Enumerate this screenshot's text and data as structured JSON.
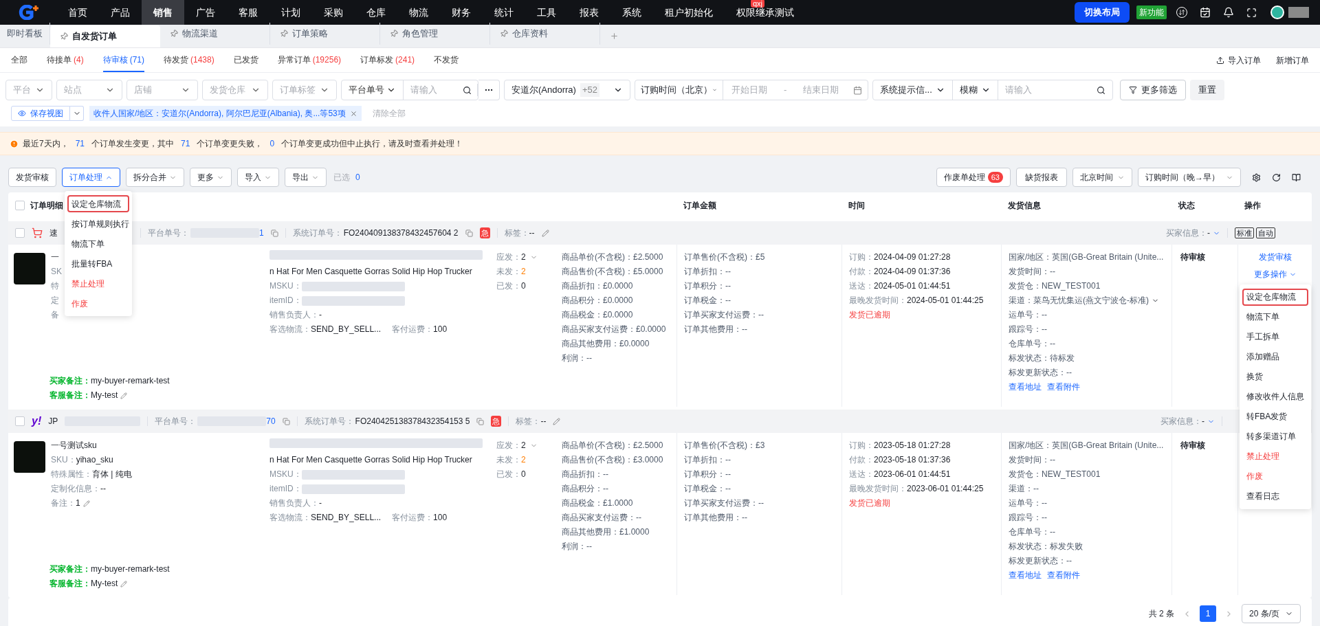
{
  "nav": {
    "items": [
      {
        "label": "首页",
        "selected": false
      },
      {
        "label": "产品",
        "selected": false
      },
      {
        "label": "销售",
        "selected": true
      },
      {
        "label": "广告",
        "selected": false
      },
      {
        "label": "客服",
        "selected": false
      },
      {
        "label": "计划",
        "selected": false
      },
      {
        "label": "采购",
        "selected": false
      },
      {
        "label": "仓库",
        "selected": false
      },
      {
        "label": "物流",
        "selected": false
      },
      {
        "label": "财务",
        "selected": false
      },
      {
        "label": "统计",
        "selected": false
      },
      {
        "label": "工具",
        "selected": false
      },
      {
        "label": "报表",
        "selected": false
      },
      {
        "label": "系统",
        "selected": false
      },
      {
        "label": "租户初始化",
        "selected": false
      },
      {
        "label": "权限继承测试",
        "selected": false,
        "badge": "qxj"
      }
    ],
    "switch_layout": "切换布局",
    "new_feature": "新功能"
  },
  "page_tabs": [
    {
      "label": "即时看板",
      "selected": false,
      "pinned": false
    },
    {
      "label": "自发货订单",
      "selected": true,
      "pinned": true
    },
    {
      "label": "物流渠道",
      "selected": false,
      "pinned": true
    },
    {
      "label": "订单策略",
      "selected": false,
      "pinned": true
    },
    {
      "label": "角色管理",
      "selected": false,
      "pinned": true
    },
    {
      "label": "仓库资料",
      "selected": false,
      "pinned": true
    }
  ],
  "status_tabs": [
    {
      "label": "全部",
      "selected": false
    },
    {
      "label": "待接单",
      "count": "(4)",
      "selected": false
    },
    {
      "label": "待审核",
      "count": "(71)",
      "selected": true
    },
    {
      "label": "待发货",
      "count": "(1438)",
      "selected": false
    },
    {
      "label": "已发货",
      "selected": false
    },
    {
      "label": "异常订单",
      "count": "(19256)",
      "selected": false
    },
    {
      "label": "订单标发",
      "count": "(241)",
      "selected": false
    },
    {
      "label": "不发货",
      "selected": false
    }
  ],
  "header_actions": {
    "import": "导入订单",
    "create": "新增订单"
  },
  "filters": {
    "selects": [
      "平台",
      "站点",
      "店铺",
      "发货仓库",
      "订单标签"
    ],
    "number_search": {
      "type": "平台单号",
      "placeholder": "请输入"
    },
    "country": {
      "value": "安道尔(Andorra)",
      "more": "+52"
    },
    "date": {
      "type": "订购时间（北京）",
      "start": "开始日期",
      "separator": "-",
      "end": "结束日期"
    },
    "text_search": {
      "field": "系统提示信...",
      "mode": "模糊",
      "placeholder": "请输入"
    },
    "more_filters": "更多筛选",
    "reset": "重置"
  },
  "view_bar": {
    "save_view": "保存视图",
    "chip": "收件人国家/地区：安道尔(Andorra), 阿尔巴尼亚(Albania), 奥...等53项",
    "clear_all": "清除全部"
  },
  "alert": [
    {
      "text": "最近7天内，",
      "kind": "plain"
    },
    {
      "text": "71",
      "kind": "number"
    },
    {
      "text": "个订单发生变更，其中",
      "kind": "plain"
    },
    {
      "text": "71",
      "kind": "number"
    },
    {
      "text": "个订单变更失败，",
      "kind": "plain"
    },
    {
      "text": "0",
      "kind": "number"
    },
    {
      "text": "个订单变更成功但中止执行，请及时查看并处理！",
      "kind": "plain"
    }
  ],
  "toolbar": {
    "buttons": [
      {
        "label": "发货审核",
        "kind": "plain",
        "open": false
      },
      {
        "label": "订单处理",
        "kind": "menu",
        "open": true
      },
      {
        "label": "拆分合并",
        "kind": "menu",
        "open": false
      },
      {
        "label": "更多",
        "kind": "menu",
        "open": false
      },
      {
        "label": "导入",
        "kind": "menu",
        "open": false
      },
      {
        "label": "导出",
        "kind": "menu",
        "open": false
      }
    ],
    "selected_label": "已选",
    "selected_count": "0",
    "void_orders": {
      "label": "作废单处理",
      "badge": "63"
    },
    "stockout_report": "缺货报表",
    "timezone": "北京时间",
    "sort": "订购时间（晚→早）"
  },
  "process_menu": [
    {
      "label": "设定仓库物流",
      "kind": "normal",
      "highlighted": true
    },
    {
      "label": "按订单规则执行",
      "kind": "normal",
      "highlighted": false
    },
    {
      "label": "物流下单",
      "kind": "normal",
      "highlighted": false
    },
    {
      "label": "批量转FBA",
      "kind": "normal",
      "highlighted": false
    },
    {
      "label": "禁止处理",
      "kind": "danger",
      "highlighted": false
    },
    {
      "label": "作废",
      "kind": "danger",
      "highlighted": false
    }
  ],
  "table": {
    "select_all": {
      "label": "订单明细",
      "checked": false
    },
    "columns": [
      "订单金额",
      "时间",
      "发货信息",
      "状态",
      "操作"
    ]
  },
  "orders": [
    {
      "checked": false,
      "platform": {
        "kind": "cart"
      },
      "store": "速",
      "platform_no_label": "平台单号：",
      "platform_no_tail": "1",
      "system_no_label": "系统订单号：",
      "system_no": "FO240409138378432457604 2",
      "urgent": "急",
      "tag_label": "标签：",
      "tag": "--",
      "buyer_info_label": "买家信息：",
      "buyer_info": "-",
      "mode_badges": [
        "标准",
        "自动"
      ],
      "product": {
        "name": "一",
        "fields": [
          {
            "label": "SK"
          },
          {
            "label": "特"
          },
          {
            "label": "定"
          },
          {
            "label": "备"
          }
        ]
      },
      "product_title": "n Hat For Men Casquette Gorras Solid Hip Hop Trucker",
      "product_fields": [
        {
          "label": "MSKU：",
          "redacted": true
        },
        {
          "label": "itemID：",
          "redacted": true
        },
        {
          "label": "销售负责人：",
          "value": "-"
        }
      ],
      "logistics": [
        {
          "label": "客选物流：",
          "value": "SEND_BY_SELL..."
        },
        {
          "label": "客付运费：",
          "value": "100"
        }
      ],
      "qty": [
        {
          "label": "应发：",
          "value": "2",
          "warn": false
        },
        {
          "label": "未发：",
          "value": "2",
          "warn": true
        },
        {
          "label": "已发：",
          "value": "0",
          "warn": false
        }
      ],
      "prices": [
        "商品单价(不含税)：£2.5000",
        "商品售价(不含税)：£5.0000",
        "商品折扣：£0.0000",
        "商品积分：£0.0000",
        "商品税金：£0.0000",
        "商品买家支付运费：£0.0000",
        "商品其他费用：£0.0000",
        "利润：--"
      ],
      "amounts": [
        "订单售价(不含税)：£5",
        "订单折扣：--",
        "订单积分：--",
        "订单税金：--",
        "订单买家支付运费：--",
        "订单其他费用：--"
      ],
      "times": [
        {
          "label": "订购：",
          "value": "2024-04-09 01:27:28"
        },
        {
          "label": "付款：",
          "value": "2024-04-09 01:37:36"
        },
        {
          "label": "送达：",
          "value": "2024-05-01 01:44:51"
        },
        {
          "label": "最晚发货时间：",
          "value": "2024-05-01 01:44:25"
        }
      ],
      "overdue": "发货已逾期",
      "shipping": [
        {
          "text": "国家/地区：英国(GB-Great Britain (Unite...",
          "expandable": false
        },
        {
          "text": "发货时间：--",
          "expandable": false
        },
        {
          "text": "发货仓：NEW_TEST001",
          "expandable": false
        },
        {
          "text": "渠道：菜鸟无忧集运(燕文宁波仓-标准)",
          "expandable": true
        },
        {
          "text": "运单号：--",
          "expandable": false
        },
        {
          "text": "跟踪号：--",
          "expandable": false
        },
        {
          "text": "仓库单号：--",
          "expandable": false
        },
        {
          "text": "标发状态：待标发",
          "expandable": false
        },
        {
          "text": "标发更新状态：--",
          "expandable": false
        }
      ],
      "links": [
        "查看地址",
        "查看附件"
      ],
      "status": "待审核",
      "actions": {
        "primary": "发货审核",
        "more": "更多操作"
      },
      "remarks": [
        {
          "label": "买家备注：",
          "value": "my-buyer-remark-test",
          "editable": false
        },
        {
          "label": "客服备注：",
          "value": "My-test",
          "editable": true
        }
      ]
    },
    {
      "checked": false,
      "platform": {
        "kind": "text",
        "mark": "y!"
      },
      "store": "JP",
      "platform_no_label": "平台单号：",
      "platform_no_tail": "70",
      "system_no_label": "系统订单号：",
      "system_no": "FO240425138378432354153 5",
      "urgent": "急",
      "tag_label": "标签：",
      "tag": "--",
      "buyer_info_label": "买家信息：",
      "buyer_info": "-",
      "product": {
        "name": "一号测试sku",
        "fields": [
          {
            "label": "SKU：",
            "value": "yihao_sku"
          },
          {
            "label": "特殊属性：",
            "value": "育体 | 纯电"
          },
          {
            "label": "定制化信息：",
            "value": "--"
          },
          {
            "label": "备注：",
            "value": "1",
            "editable": true
          }
        ]
      },
      "product_title": "n Hat For Men Casquette Gorras Solid Hip Hop Trucker",
      "product_fields": [
        {
          "label": "MSKU：",
          "redacted": true
        },
        {
          "label": "itemID：",
          "redacted": true
        },
        {
          "label": "销售负责人：",
          "value": "-"
        }
      ],
      "logistics": [
        {
          "label": "客选物流：",
          "value": "SEND_BY_SELL..."
        },
        {
          "label": "客付运费：",
          "value": "100"
        }
      ],
      "qty": [
        {
          "label": "应发：",
          "value": "2",
          "warn": false
        },
        {
          "label": "未发：",
          "value": "2",
          "warn": true
        },
        {
          "label": "已发：",
          "value": "0",
          "warn": false
        }
      ],
      "prices": [
        "商品单价(不含税)：£2.5000",
        "商品售价(不含税)：£3.0000",
        "商品折扣：--",
        "商品积分：--",
        "商品税金：£1.0000",
        "商品买家支付运费：--",
        "商品其他费用：£1.0000",
        "利润：--"
      ],
      "amounts": [
        "订单售价(不含税)：£3",
        "订单折扣：--",
        "订单积分：--",
        "订单税金：--",
        "订单买家支付运费：--",
        "订单其他费用：--"
      ],
      "times": [
        {
          "label": "订购：",
          "value": "2023-05-18 01:27:28"
        },
        {
          "label": "付款：",
          "value": "2023-05-18 01:37:36"
        },
        {
          "label": "送达：",
          "value": "2023-06-01 01:44:51"
        },
        {
          "label": "最晚发货时间：",
          "value": "2023-06-01 01:44:25"
        }
      ],
      "overdue": "发货已逾期",
      "shipping": [
        {
          "text": "国家/地区：英国(GB-Great Britain (Unite...",
          "expandable": false
        },
        {
          "text": "发货时间：--",
          "expandable": false
        },
        {
          "text": "发货仓：NEW_TEST001",
          "expandable": false
        },
        {
          "text": "渠道：--",
          "expandable": false
        },
        {
          "text": "运单号：--",
          "expandable": false
        },
        {
          "text": "跟踪号：--",
          "expandable": false
        },
        {
          "text": "仓库单号：--",
          "expandable": false
        },
        {
          "text": "标发状态：标发失败",
          "expandable": false
        },
        {
          "text": "标发更新状态：--",
          "expandable": false
        }
      ],
      "links": [
        "查看地址",
        "查看附件"
      ],
      "status": "待审核",
      "remarks": [
        {
          "label": "买家备注：",
          "value": "my-buyer-remark-test",
          "editable": false
        },
        {
          "label": "客服备注：",
          "value": "My-test",
          "editable": true
        }
      ]
    }
  ],
  "more_actions_menu": [
    {
      "label": "设定仓库物流",
      "kind": "normal",
      "highlighted": true
    },
    {
      "label": "物流下单",
      "kind": "normal",
      "highlighted": false
    },
    {
      "label": "手工拆单",
      "kind": "normal",
      "highlighted": false
    },
    {
      "label": "添加赠品",
      "kind": "normal",
      "highlighted": false
    },
    {
      "label": "换货",
      "kind": "normal",
      "highlighted": false
    },
    {
      "label": "修改收件人信息",
      "kind": "normal",
      "highlighted": false
    },
    {
      "label": "转FBA发货",
      "kind": "normal",
      "highlighted": false
    },
    {
      "label": "转多渠道订单",
      "kind": "normal",
      "highlighted": false
    },
    {
      "label": "禁止处理",
      "kind": "danger",
      "highlighted": false
    },
    {
      "label": "作废",
      "kind": "danger",
      "highlighted": false
    },
    {
      "label": "查看日志",
      "kind": "normal",
      "highlighted": false
    }
  ],
  "pagination": {
    "total": "共 2 条",
    "pages": [
      {
        "label": "1",
        "selected": true
      }
    ],
    "page_size": "20 条/页"
  }
}
